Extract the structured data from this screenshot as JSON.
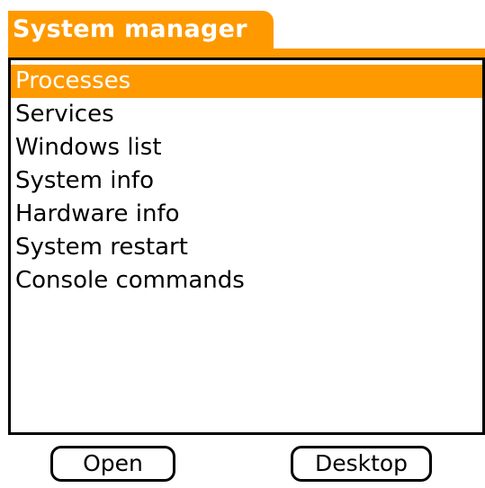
{
  "title": "System manager",
  "menu": {
    "items": [
      {
        "label": "Processes",
        "selected": true
      },
      {
        "label": "Services",
        "selected": false
      },
      {
        "label": "Windows list",
        "selected": false
      },
      {
        "label": "System info",
        "selected": false
      },
      {
        "label": "Hardware info",
        "selected": false
      },
      {
        "label": "System restart",
        "selected": false
      },
      {
        "label": "Console commands",
        "selected": false
      }
    ]
  },
  "buttons": {
    "open_label": "Open",
    "desktop_label": "Desktop"
  },
  "colors": {
    "accent": "#FF9900",
    "text": "#000000",
    "background": "#FFFFFF"
  }
}
